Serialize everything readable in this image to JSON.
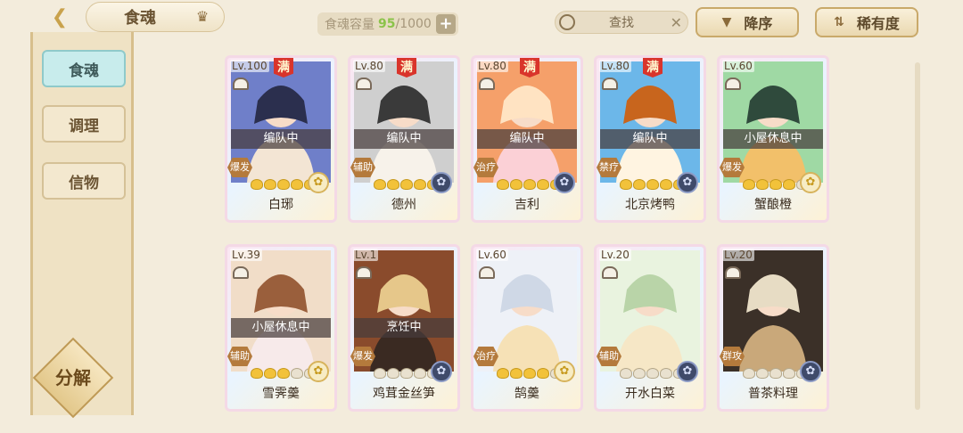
{
  "header": {
    "back_icon": "back-arrow-icon",
    "title": "食魂",
    "capacity_label": "食魂容量",
    "capacity_current": "95",
    "capacity_max": "/1000",
    "capacity_plus": "+",
    "search_placeholder": "查找",
    "search_clear": "✕",
    "sort_desc_label": "降序",
    "sort_desc_icon": "▼",
    "sort_rarity_label": "稀有度",
    "sort_rarity_icon": "⇅"
  },
  "sidebar": {
    "tabs": [
      {
        "label": "食魂",
        "active": true
      },
      {
        "label": "调理",
        "active": false
      },
      {
        "label": "信物",
        "active": false
      }
    ],
    "decompose_label": "分解"
  },
  "cards": [
    {
      "level": "Lv.100",
      "max": "满",
      "status": "编队中",
      "role": "爆发",
      "stars": 5,
      "gem": "gold",
      "name": "白琊",
      "palette": [
        "#6f7fc9",
        "#2b2f4e",
        "#f3e5d4"
      ]
    },
    {
      "level": "Lv.80",
      "max": "满",
      "status": "编队中",
      "role": "辅助",
      "stars": 5,
      "gem": "dark",
      "name": "德州",
      "palette": [
        "#cfcfcf",
        "#3a3a3a",
        "#f7f2ea"
      ]
    },
    {
      "level": "Lv.80",
      "max": "满",
      "status": "编队中",
      "role": "治疗",
      "stars": 5,
      "gem": "dark",
      "name": "吉利",
      "palette": [
        "#f5a06a",
        "#ffe3c2",
        "#fbd0d6"
      ]
    },
    {
      "level": "Lv.80",
      "max": "满",
      "status": "编队中",
      "role": "禁疗",
      "stars": 5,
      "gem": "dark",
      "name": "北京烤鸭",
      "palette": [
        "#6cb7e9",
        "#c8651d",
        "#fff4e1"
      ]
    },
    {
      "level": "Lv.60",
      "max": "",
      "status": "小屋休息中",
      "role": "爆发",
      "stars": 4,
      "gem": "gold",
      "name": "蟹酿橙",
      "palette": [
        "#9fd9a4",
        "#2f4a3c",
        "#f2c06a"
      ]
    },
    {
      "level": "Lv.39",
      "max": "",
      "status": "小屋休息中",
      "role": "辅助",
      "stars": 3,
      "gem": "gold",
      "name": "雪霁羹",
      "palette": [
        "#f1ddc8",
        "#9a5f3c",
        "#f7eaea"
      ]
    },
    {
      "level": "Lv.1",
      "max": "",
      "status": "烹饪中",
      "role": "爆发",
      "stars": 0,
      "gem": "dark",
      "name": "鸡茸金丝笋",
      "palette": [
        "#8a4b2c",
        "#e6c78a",
        "#3a2a22"
      ]
    },
    {
      "level": "Lv.60",
      "max": "",
      "status": "",
      "role": "治疗",
      "stars": 4,
      "gem": "gold",
      "name": "鹄羹",
      "palette": [
        "#eef1f7",
        "#cfd8e6",
        "#f6e1b6"
      ]
    },
    {
      "level": "Lv.20",
      "max": "",
      "status": "",
      "role": "辅助",
      "stars": 0,
      "gem": "dark",
      "name": "开水白菜",
      "palette": [
        "#e9f3df",
        "#b9d4a8",
        "#f6e7c6"
      ]
    },
    {
      "level": "Lv.20",
      "max": "",
      "status": "",
      "role": "群攻",
      "stars": 0,
      "gem": "dark",
      "name": "普茶料理",
      "palette": [
        "#3b3028",
        "#e7dcc4",
        "#c9a87a"
      ]
    }
  ]
}
